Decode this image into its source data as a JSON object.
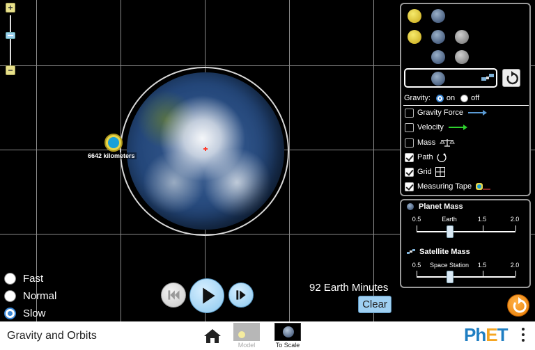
{
  "app": {
    "title": "Gravity and Orbits"
  },
  "measuring_tape": {
    "readout": "6642 kilometers"
  },
  "speed": {
    "options": [
      {
        "label": "Fast",
        "selected": false
      },
      {
        "label": "Normal",
        "selected": false
      },
      {
        "label": "Slow",
        "selected": true
      }
    ]
  },
  "time": {
    "readout": "92 Earth Minutes",
    "clear_label": "Clear"
  },
  "gravity": {
    "label": "Gravity:",
    "on_label": "on",
    "off_label": "off",
    "selected": "on"
  },
  "options": {
    "gravity_force": {
      "label": "Gravity Force",
      "checked": false,
      "color": "#5b9bd5"
    },
    "velocity": {
      "label": "Velocity",
      "checked": false,
      "color": "#2ed12e"
    },
    "mass": {
      "label": "Mass",
      "checked": false
    },
    "path": {
      "label": "Path",
      "checked": true
    },
    "grid": {
      "label": "Grid",
      "checked": true
    },
    "measuring_tape": {
      "label": "Measuring Tape",
      "checked": true
    }
  },
  "planet_mass": {
    "title": "Planet Mass",
    "ticks": [
      "0.5",
      "Earth",
      "1.5",
      "2.0"
    ],
    "value_label": "Earth"
  },
  "satellite_mass": {
    "title": "Satellite Mass",
    "ticks": [
      "0.5",
      "Space Station",
      "1.5",
      "2.0"
    ],
    "value_label": "Space Station"
  },
  "nav": {
    "screens": [
      {
        "label": "Model",
        "active": false
      },
      {
        "label": "To Scale",
        "active": true
      }
    ],
    "logo": {
      "ph": "Ph",
      "e": "E",
      "t": "T"
    }
  },
  "colors": {
    "accent": "#3b87d6",
    "play": "#8bc8ef",
    "reset": "#e77a00"
  }
}
